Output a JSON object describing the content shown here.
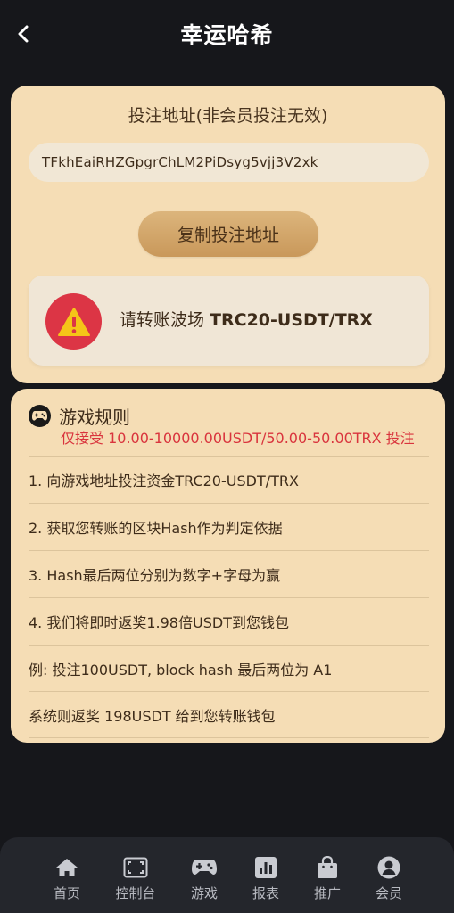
{
  "header": {
    "title": "幸运哈希"
  },
  "address_card": {
    "title": "投注地址(非会员投注无效)",
    "address": "TFkhEaiRHZGpgrChLM2PiDsyg5vjj3V2xk",
    "copy_label": "复制投注地址",
    "warning_prefix": "请转账波场 ",
    "warning_bold": "TRC20-USDT/TRX"
  },
  "rules_card": {
    "title": "游戏规则",
    "subtitle": "仅接受 10.00-10000.00USDT/50.00-50.00TRX 投注",
    "items": [
      "1. 向游戏地址投注资金TRC20-USDT/TRX",
      "2. 获取您转账的区块Hash作为判定依据",
      "3. Hash最后两位分别为数字+字母为赢",
      "4. 我们将即时返奖1.98倍USDT到您钱包",
      "例: 投注100USDT, block hash 最后两位为 A1",
      "系统则返奖 198USDT 给到您转账钱包"
    ]
  },
  "nav": {
    "items": [
      {
        "label": "首页",
        "icon": "home-icon"
      },
      {
        "label": "控制台",
        "icon": "console-icon"
      },
      {
        "label": "游戏",
        "icon": "gamepad-icon"
      },
      {
        "label": "报表",
        "icon": "report-icon"
      },
      {
        "label": "推广",
        "icon": "bag-icon"
      },
      {
        "label": "会员",
        "icon": "user-icon"
      }
    ]
  },
  "colors": {
    "background": "#16171b",
    "card": "#f5ddb5",
    "accent_red": "#dc3545",
    "subtitle_red": "#d9343d",
    "button_gold": "#d4a86b",
    "nav_bg": "#24262c"
  }
}
